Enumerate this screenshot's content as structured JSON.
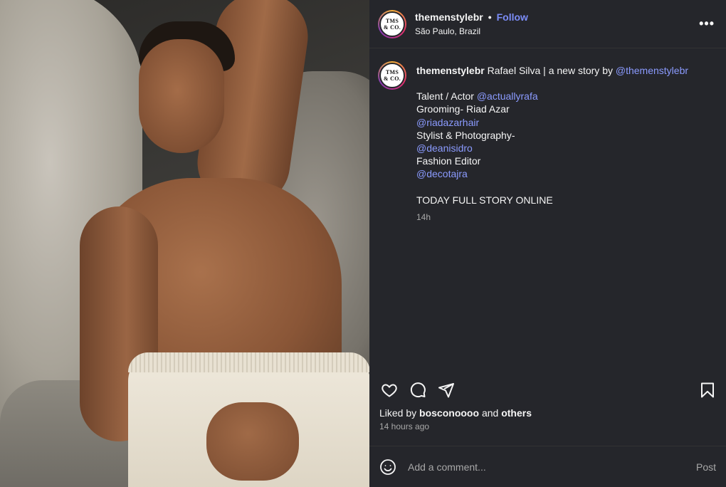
{
  "post": {
    "username": "themenstylebr",
    "follow_label": "Follow",
    "location": "São Paulo, Brazil",
    "avatar_text_line1": "TMS",
    "avatar_text_line2": "& CO."
  },
  "caption": {
    "username": "themenstylebr",
    "intro": "Rafael Silva | a new story by",
    "intro_mention": "@themenstylebr",
    "talent_label": "Talent / Actor",
    "talent_mention": "@actuallyrafa",
    "grooming_label": "Grooming- Riad Azar",
    "grooming_mention": "@riadazarhair",
    "stylist_label": "Stylist & Photography-",
    "stylist_mention": "@deanisidro",
    "editor_label": "Fashion Editor",
    "editor_mention": "@decotajra",
    "closing": "TODAY FULL STORY ONLINE",
    "age": "14h"
  },
  "engagement": {
    "liked_by_prefix": "Liked by",
    "liked_by_user": "bosconoooo",
    "liked_by_and": "and",
    "liked_by_others": "others",
    "posted_time": "14 hours ago"
  },
  "comment": {
    "placeholder": "Add a comment...",
    "post_label": "Post"
  },
  "icons": {
    "like": "heart-icon",
    "comment": "comment-icon",
    "share": "share-icon",
    "save": "bookmark-icon",
    "emoji": "emoji-icon",
    "more": "more-options-icon"
  },
  "colors": {
    "panel_bg": "#25262b",
    "mention": "#8b9bff",
    "follow": "#7b8cf7",
    "muted": "#a8a8a8"
  }
}
